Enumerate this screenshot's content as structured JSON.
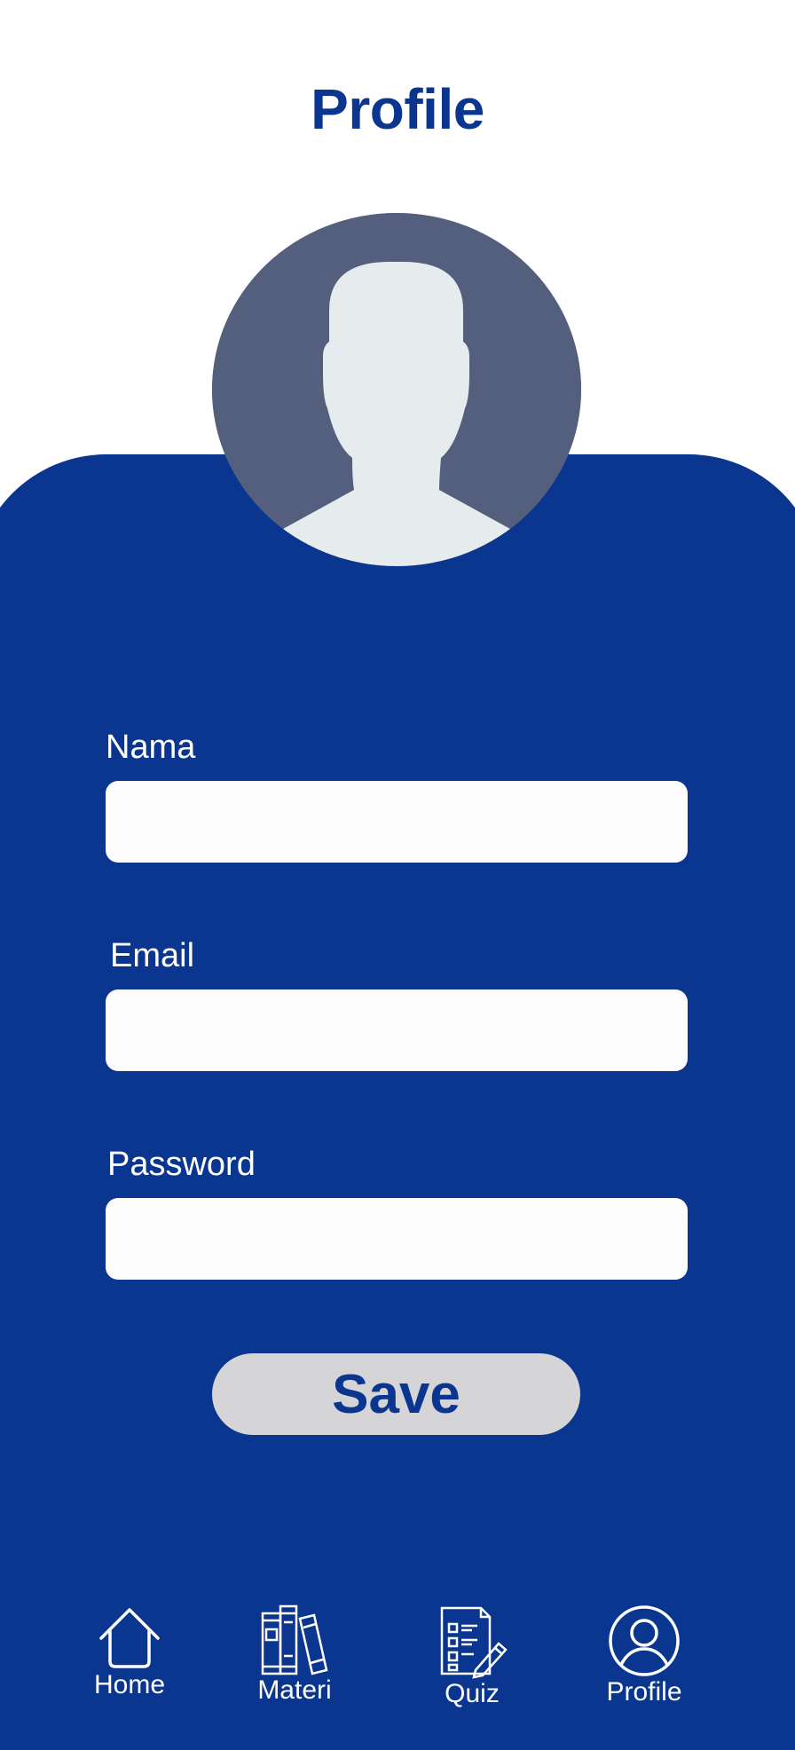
{
  "header": {
    "title": "Profile"
  },
  "form": {
    "name_label": "Nama",
    "name_value": "",
    "email_label": "Email",
    "email_value": "",
    "password_label": "Password",
    "password_value": "",
    "save_label": "Save"
  },
  "nav": {
    "items": [
      {
        "label": "Home",
        "icon": "home-icon"
      },
      {
        "label": "Materi",
        "icon": "books-icon"
      },
      {
        "label": "Quiz",
        "icon": "quiz-checklist-icon"
      },
      {
        "label": "Profile",
        "icon": "user-circle-icon"
      }
    ]
  },
  "colors": {
    "primary": "#0a3690",
    "avatar_bg": "#545f7e",
    "avatar_fg": "#e6ebed",
    "save_button_bg": "#d5d5d7",
    "input_bg": "#fdfdfd"
  }
}
